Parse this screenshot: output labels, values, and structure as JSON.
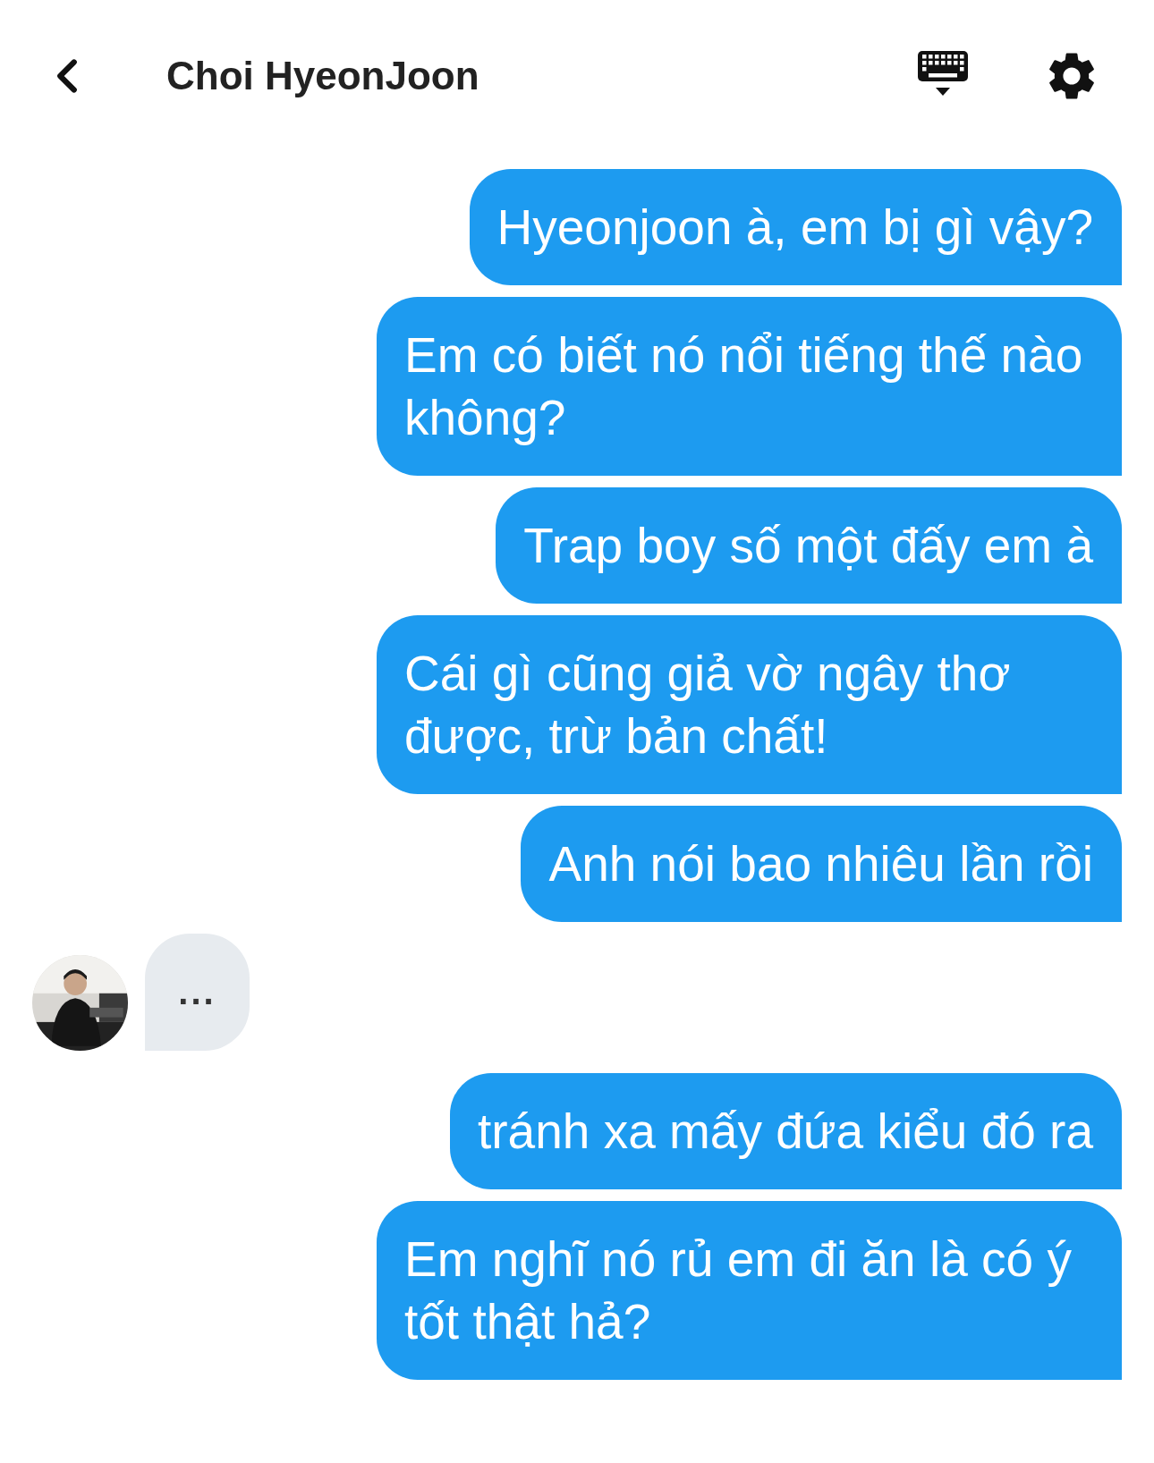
{
  "header": {
    "title": "Choi HyeonJoon"
  },
  "messages": [
    {
      "kind": "outgoing",
      "text": "Hyeonjoon à, em bị gì vậy?"
    },
    {
      "kind": "outgoing",
      "text": "Em có biết nó nổi tiếng thế nào không?"
    },
    {
      "kind": "outgoing",
      "text": "Trap boy số một đấy em à"
    },
    {
      "kind": "outgoing",
      "text": "Cái gì cũng giả vờ ngây thơ được, trừ bản chất!"
    },
    {
      "kind": "outgoing",
      "text": "Anh nói bao nhiêu lần rồi"
    },
    {
      "kind": "typing",
      "text": "..."
    },
    {
      "kind": "outgoing",
      "text": "tránh xa mấy đứa kiểu đó ra"
    },
    {
      "kind": "outgoing",
      "text": "Em nghĩ nó rủ em đi ăn là có ý tốt thật hả?"
    }
  ]
}
